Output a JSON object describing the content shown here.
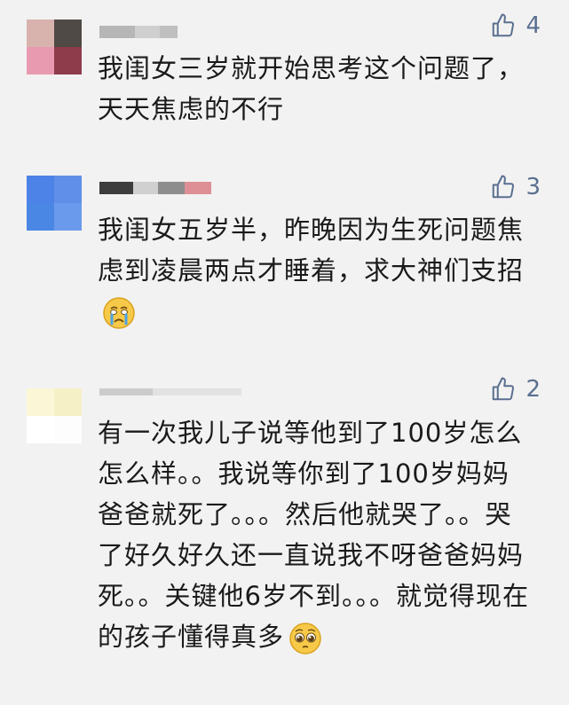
{
  "comments": [
    {
      "likes": "4",
      "text": "我闺女三岁就开始思考这个问题了，天天焦虑的不行",
      "avatar_colors": [
        "#d8b2ad",
        "#4f4a45",
        "#e89bb0",
        "#8e3b4b"
      ],
      "username_blocks": [
        "#b6b6b6",
        "#cfcfcf",
        "#bfbfbf"
      ]
    },
    {
      "likes": "3",
      "text": "我闺女五岁半，昨晚因为生死问题焦虑到凌晨两点才睡着，求大神们支招",
      "emoji": "crying-face-icon",
      "avatar_colors": [
        "#4d82e6",
        "#5f8fe9",
        "#4a86e4",
        "#6a9aeb"
      ],
      "username_blocks": [
        "#3d3d3d",
        "#d0d0d0",
        "#8d8d8d",
        "#de8f95"
      ]
    },
    {
      "likes": "2",
      "text": "有一次我儿子说等他到了100岁怎么怎么样。。我说等你到了100岁妈妈爸爸就死了。。。然后他就哭了。。哭了好久好久还一直说我不呀爸爸妈妈死。。关键他6岁不到。。。就觉得现在的孩子懂得真多",
      "emoji": "pleading-face-icon",
      "avatar_colors": [
        "#fbf7d6",
        "#f6f0c6",
        "#ffffff",
        "#fdfdfd"
      ],
      "username_blocks": [
        "#cccccc",
        "#e2e2e2"
      ]
    }
  ]
}
